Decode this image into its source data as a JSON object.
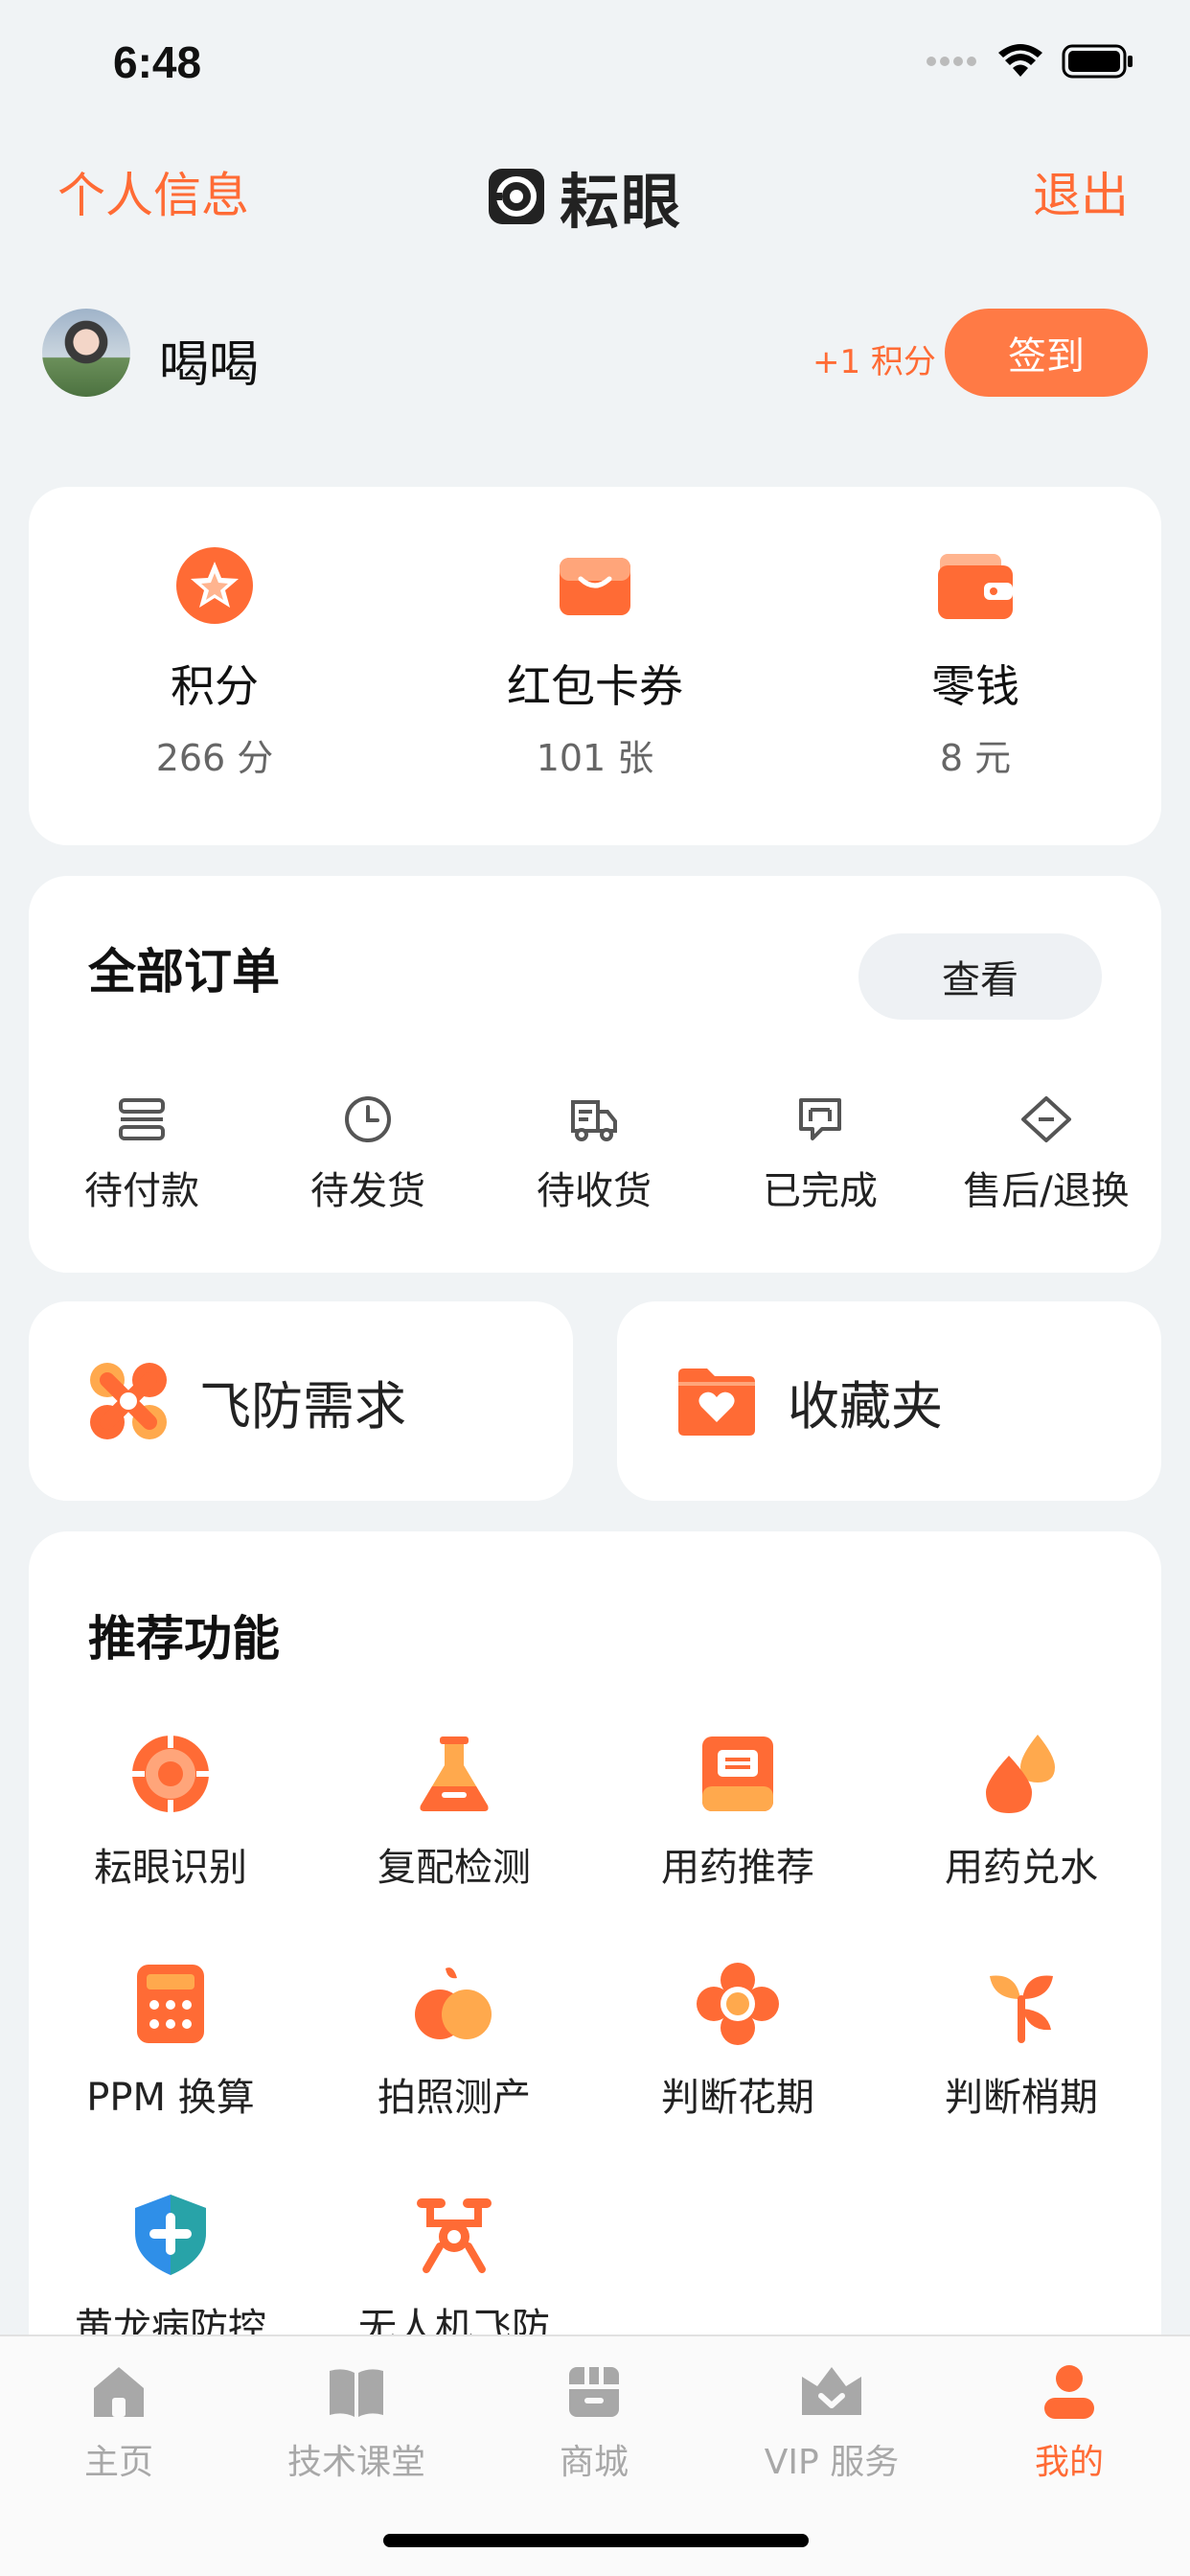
{
  "status_bar": {
    "time": "6:48"
  },
  "header": {
    "left_link": "个人信息",
    "logo_text": "耘眼",
    "right_link": "退出"
  },
  "user": {
    "name": "喝喝",
    "points_hint": "+1 积分",
    "signin_label": "签到"
  },
  "wallet": [
    {
      "label": "积分",
      "value": "266 分",
      "icon": "star-icon"
    },
    {
      "label": "红包卡券",
      "value": "101 张",
      "icon": "coupon-icon"
    },
    {
      "label": "零钱",
      "value": "8 元",
      "icon": "wallet-icon"
    }
  ],
  "orders": {
    "title": "全部订单",
    "view_label": "查看",
    "items": [
      {
        "label": "待付款",
        "icon": "card-icon"
      },
      {
        "label": "待发货",
        "icon": "clock-icon"
      },
      {
        "label": "待收货",
        "icon": "truck-icon"
      },
      {
        "label": "已完成",
        "icon": "check-box-icon"
      },
      {
        "label": "售后/退换",
        "icon": "tag-icon"
      }
    ]
  },
  "quick": [
    {
      "label": "飞防需求",
      "icon": "drone-icon"
    },
    {
      "label": "收藏夹",
      "icon": "favorite-folder-icon"
    }
  ],
  "recommend": {
    "title": "推荐功能",
    "items": [
      {
        "label": "耘眼识别",
        "icon": "target-icon"
      },
      {
        "label": "复配检测",
        "icon": "flask-icon"
      },
      {
        "label": "用药推荐",
        "icon": "book-icon"
      },
      {
        "label": "用药兑水",
        "icon": "drops-icon"
      },
      {
        "label": "PPM 换算",
        "icon": "calculator-icon"
      },
      {
        "label": "拍照测产",
        "icon": "fruit-icon"
      },
      {
        "label": "判断花期",
        "icon": "flower-icon"
      },
      {
        "label": "判断梢期",
        "icon": "sprout-icon"
      },
      {
        "label": "黄龙病防控",
        "icon": "shield-plus-icon"
      },
      {
        "label": "无人机飞防",
        "icon": "drone-icon"
      }
    ]
  },
  "tabs": [
    {
      "label": "主页",
      "icon": "home-icon",
      "active": false
    },
    {
      "label": "技术课堂",
      "icon": "book-open-icon",
      "active": false
    },
    {
      "label": "商城",
      "icon": "shop-icon",
      "active": false
    },
    {
      "label": "VIP 服务",
      "icon": "crown-icon",
      "active": false
    },
    {
      "label": "我的",
      "icon": "user-icon",
      "active": true
    }
  ],
  "colors": {
    "accent": "#ff6b35",
    "background": "#f0f3f5",
    "inactive_tab": "#a8a8a8"
  }
}
